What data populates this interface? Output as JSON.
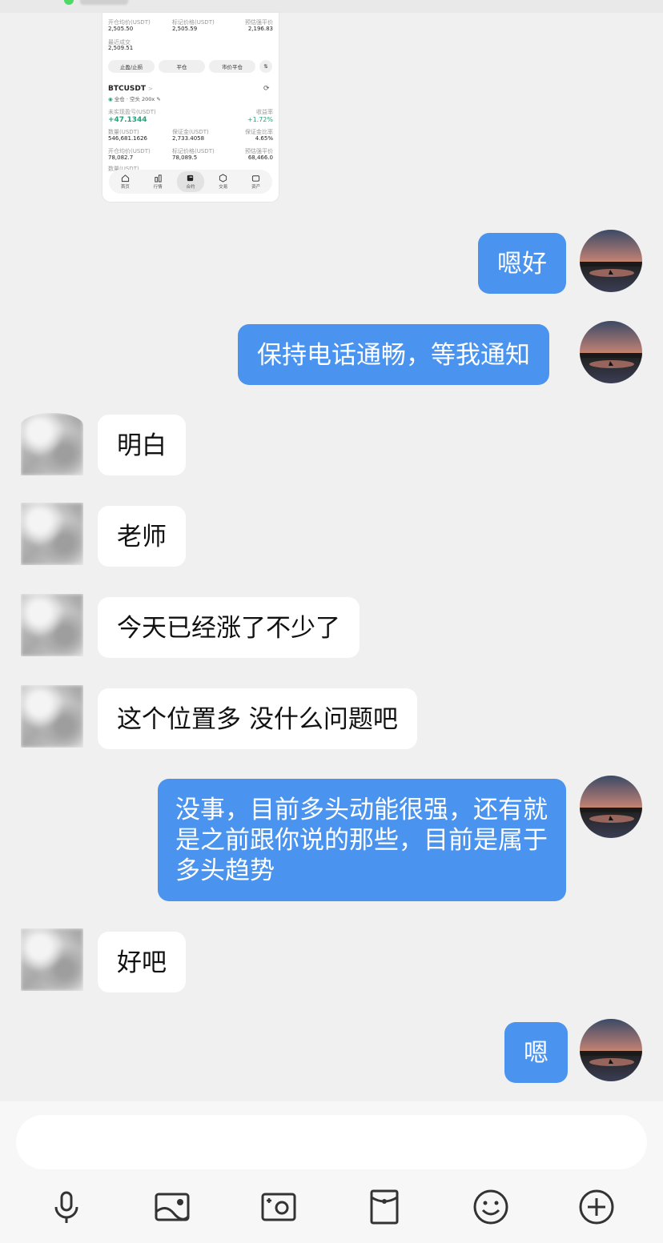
{
  "screenshot_card": {
    "row1": [
      {
        "label": "开仓均价(USDT)",
        "value": "2,505.50"
      },
      {
        "label": "标记价格(USDT)",
        "value": "2,505.59"
      },
      {
        "label": "预估强平价",
        "value": "2,196.83"
      }
    ],
    "row2": {
      "label": "最近成交",
      "value": "2,509.51"
    },
    "buttons": [
      "止盈/止损",
      "平仓",
      "市价平仓",
      "⇅"
    ],
    "symbol": "BTCUSDT",
    "symbol_arrow": ">",
    "tags": "全仓 · 空头  200x ✎",
    "pnl_label": "未实现盈亏(USDT)",
    "pnl_value": "+47.1344",
    "roe_label": "收益率",
    "roe_value": "+1.72%",
    "row3": [
      {
        "label": "数量(USDT)",
        "value": "546,681.1626"
      },
      {
        "label": "保证金(USDT)",
        "value": "2,733.4058"
      },
      {
        "label": "保证金比率",
        "value": "4.65%"
      }
    ],
    "row4": [
      {
        "label": "开仓均价(USDT)",
        "value": "78,082.7"
      },
      {
        "label": "标记价格(USDT)",
        "value": "78,089.5"
      },
      {
        "label": "预估强平价",
        "value": "68,466.0"
      }
    ],
    "row5_label": "数量(USDT)",
    "nav": [
      "首页",
      "行情",
      "合约",
      "交易",
      "资产"
    ]
  },
  "messages": [
    {
      "side": "out",
      "text": "嗯好"
    },
    {
      "side": "out",
      "text": "保持电话通畅，等我通知"
    },
    {
      "side": "in",
      "text": "明白"
    },
    {
      "side": "in",
      "text": "老师"
    },
    {
      "side": "in",
      "text": "今天已经涨了不少了"
    },
    {
      "side": "in",
      "text": "这个位置多 没什么问题吧"
    },
    {
      "side": "out",
      "text": "没事，目前多头动能很强，还有就是之前跟你说的那些，目前是属于多头趋势"
    },
    {
      "side": "in",
      "text": "好吧"
    },
    {
      "side": "out",
      "text": "嗯"
    }
  ],
  "input": {
    "placeholder": ""
  },
  "toolbar": [
    "microphone-icon",
    "image-icon",
    "camera-icon",
    "red-packet-icon",
    "emoji-icon",
    "plus-icon"
  ],
  "colors": {
    "outgoing_bubble": "#4a94ef",
    "incoming_bubble": "#ffffff",
    "background": "#f0f0f0"
  }
}
